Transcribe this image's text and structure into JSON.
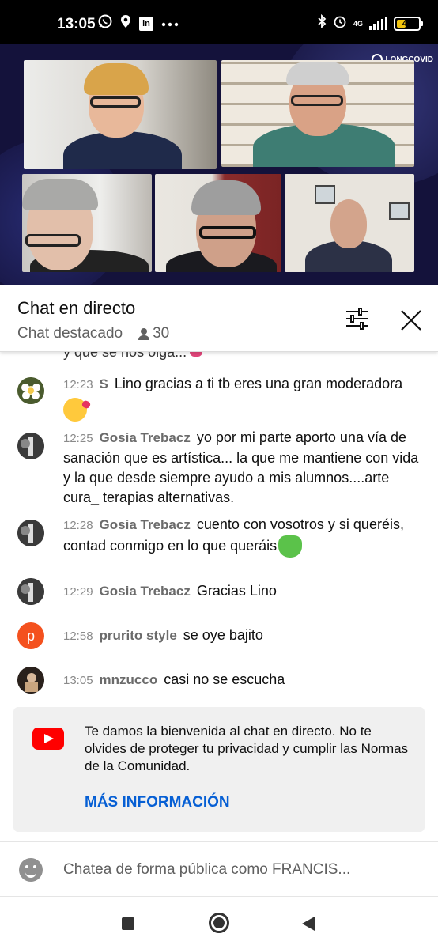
{
  "status_bar": {
    "time": "13:05",
    "network": "4G",
    "battery": "41",
    "battery_level": 0.41,
    "icons": [
      "whatsapp-icon",
      "location-icon",
      "linkedin-icon",
      "more-icon",
      "bluetooth-icon",
      "alarm-icon",
      "signal-icon",
      "battery-icon"
    ]
  },
  "video": {
    "brand": "LONGCOVID"
  },
  "chat_header": {
    "title": "Chat en directo",
    "mode": "Chat destacado",
    "viewers": "30"
  },
  "messages": [
    {
      "time": "12:23",
      "author": "S",
      "text": "Lino gracias a ti tb eres una gran moderadora",
      "emoji": "kissing-face-emoji"
    },
    {
      "time": "12:25",
      "author": "Gosia Trebacz",
      "text": "yo por mi parte aporto una vía de sanación que es artística... la que me mantiene con vida y la que desde siempre ayudo a mis alumnos....arte cura_ terapias alternativas."
    },
    {
      "time": "12:28",
      "author": "Gosia Trebacz",
      "text": "cuento con vosotros y si queréis, contad conmigo en lo que queráis",
      "emoji": "green-heart-emoji"
    },
    {
      "time": "12:29",
      "author": "Gosia Trebacz",
      "text": "Gracias Lino"
    },
    {
      "time": "12:58",
      "author": "prurito style",
      "text": "se oye bajito",
      "avatar_letter": "p",
      "avatar_color": "#f4511e"
    },
    {
      "time": "13:05",
      "author": "mnzucco",
      "text": "casi no se escucha"
    }
  ],
  "clipped_message": "y que se nos oiga...",
  "welcome": {
    "text": "Te damos la bienvenida al chat en directo. No te olvides de proteger tu privacidad y cumplir las Normas de la Comunidad.",
    "link": "MÁS INFORMACIÓN"
  },
  "input": {
    "placeholder": "Chatea de forma pública como FRANCIS..."
  },
  "colors": {
    "accent_link": "#065fd4",
    "youtube_red": "#ff0000",
    "progress_red": "#e00000",
    "video_bg": "#14123b"
  }
}
